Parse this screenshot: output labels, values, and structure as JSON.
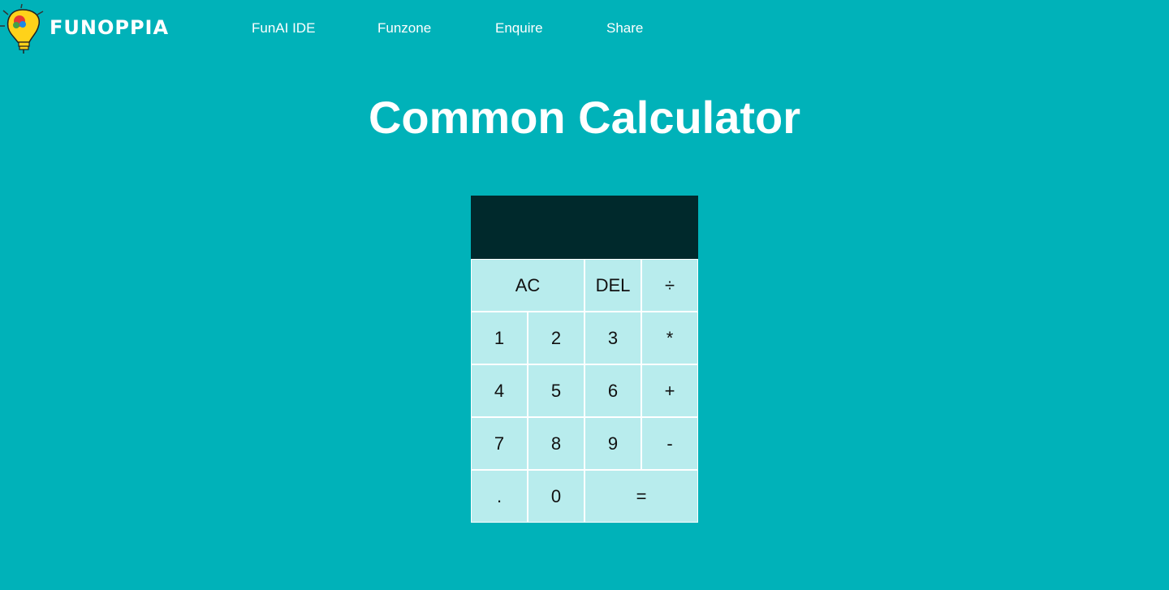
{
  "brand": {
    "name": "FUNOPPIA",
    "logo_icon": "lightbulb-logo-icon"
  },
  "nav": {
    "items": [
      {
        "label": "FunAI IDE"
      },
      {
        "label": "Funzone"
      },
      {
        "label": "Enquire"
      },
      {
        "label": "Share"
      }
    ]
  },
  "page": {
    "title": "Common Calculator"
  },
  "calculator": {
    "display_value": "",
    "keys": {
      "ac": "AC",
      "del": "DEL",
      "divide": "÷",
      "one": "1",
      "two": "2",
      "three": "3",
      "multiply": "*",
      "four": "4",
      "five": "5",
      "six": "6",
      "plus": "+",
      "seven": "7",
      "eight": "8",
      "nine": "9",
      "minus": "-",
      "dot": ".",
      "zero": "0",
      "equals": "="
    }
  },
  "colors": {
    "background": "#00b2b9",
    "display_background": "#00292c",
    "key_background": "#b8eced",
    "text_light": "#ffffff"
  }
}
